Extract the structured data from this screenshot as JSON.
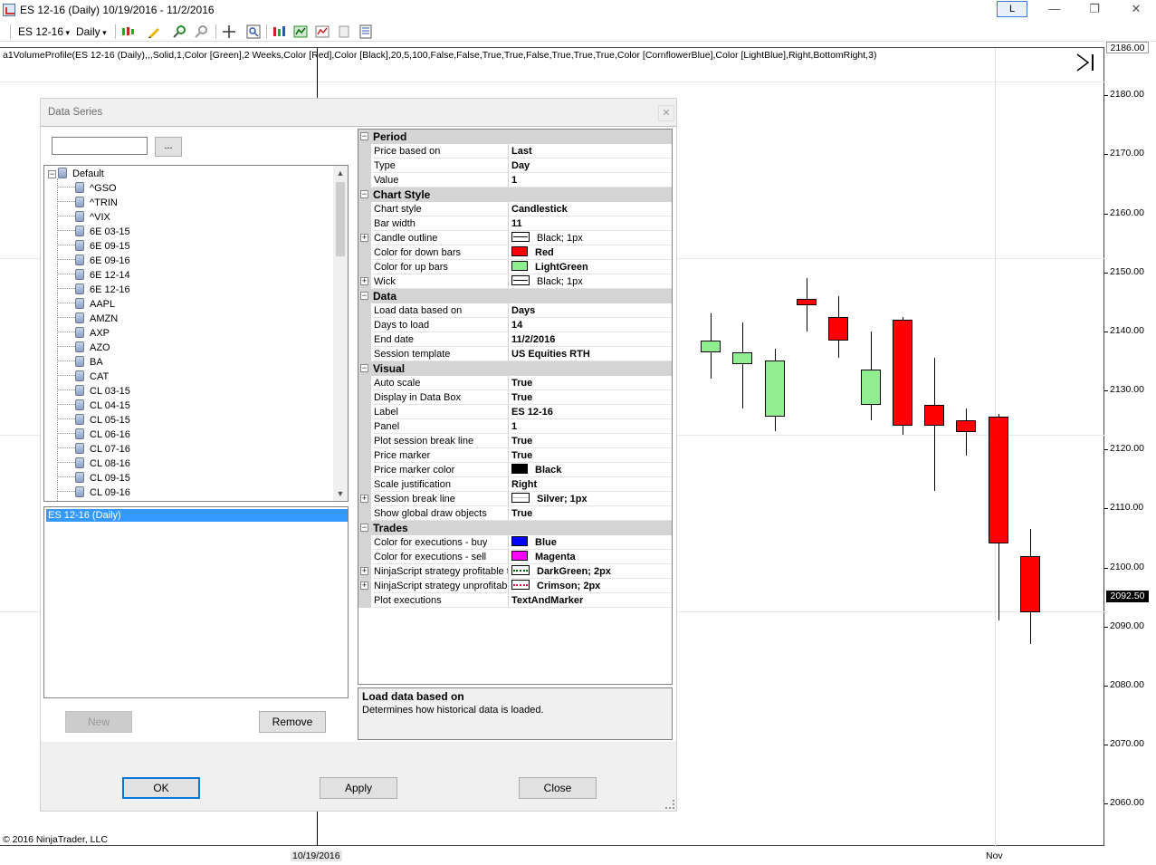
{
  "window": {
    "title": "ES 12-16 (Daily)  10/19/2016 - 11/2/2016",
    "layout_button": "L",
    "minimize": "—",
    "restore": "❐",
    "close": "✕"
  },
  "toolbar": {
    "instrument": "ES 12-16",
    "interval": "Daily"
  },
  "chart": {
    "indicator_label": "a1VolumeProfile(ES 12-16 (Daily),,,Solid,1,Color [Green],2 Weeks,Color [Red],Color [Black],20,5,100,False,False,True,True,False,True,True,True,Color [CornflowerBlue],Color [LightBlue],Right,BottomRight,3)",
    "copyright": "© 2016 NinjaTrader, LLC",
    "y_ticks": [
      "2180.00",
      "2170.00",
      "2160.00",
      "2150.00",
      "2140.00",
      "2130.00",
      "2120.00",
      "2110.00",
      "2100.00",
      "2090.00",
      "2080.00",
      "2070.00",
      "2060.00"
    ],
    "top_price_tag": "2186.00",
    "last_price_tag": "2092.50",
    "x_labels": [
      "10/19/2016",
      "Nov"
    ],
    "colors": {
      "up": "#90ee90",
      "down": "#ff0000",
      "tag_bg": "#000000"
    }
  },
  "chart_data": {
    "type": "candlestick",
    "ylim": [
      2053,
      2188
    ],
    "candles": [
      {
        "o": 2136.5,
        "h": 2143.0,
        "l": 2132.0,
        "c": 2138.5,
        "dir": "up"
      },
      {
        "o": 2134.5,
        "h": 2141.5,
        "l": 2127.0,
        "c": 2136.5,
        "dir": "up"
      },
      {
        "o": 2125.5,
        "h": 2137.0,
        "l": 2123.0,
        "c": 2135.0,
        "dir": "up"
      },
      {
        "o": 2145.5,
        "h": 2149.0,
        "l": 2140.0,
        "c": 2144.5,
        "dir": "down"
      },
      {
        "o": 2142.5,
        "h": 2146.0,
        "l": 2135.5,
        "c": 2138.5,
        "dir": "down"
      },
      {
        "o": 2127.5,
        "h": 2140.0,
        "l": 2125.0,
        "c": 2133.5,
        "dir": "up"
      },
      {
        "o": 2142.0,
        "h": 2142.5,
        "l": 2122.5,
        "c": 2124.0,
        "dir": "down"
      },
      {
        "o": 2127.5,
        "h": 2135.5,
        "l": 2113.0,
        "c": 2124.0,
        "dir": "down"
      },
      {
        "o": 2125.0,
        "h": 2127.0,
        "l": 2119.0,
        "c": 2123.0,
        "dir": "down"
      },
      {
        "o": 2125.5,
        "h": 2126.0,
        "l": 2091.0,
        "c": 2104.0,
        "dir": "down"
      },
      {
        "o": 2102.0,
        "h": 2106.5,
        "l": 2087.0,
        "c": 2092.5,
        "dir": "down"
      }
    ]
  },
  "dialog": {
    "title": "Data Series",
    "close_label": "✕",
    "search_value": "",
    "browse_label": "...",
    "tree_root": "Default",
    "instruments": [
      "^GSO",
      "^TRIN",
      "^VIX",
      "6E 03-15",
      "6E 09-15",
      "6E 09-16",
      "6E 12-14",
      "6E 12-16",
      "AAPL",
      "AMZN",
      "AXP",
      "AZO",
      "BA",
      "CAT",
      "CL 03-15",
      "CL 04-15",
      "CL 05-15",
      "CL 06-16",
      "CL 07-16",
      "CL 08-16",
      "CL 09-15",
      "CL 09-16"
    ],
    "selected_series": "ES 12-16 (Daily)",
    "new_label": "New",
    "remove_label": "Remove",
    "ok_label": "OK",
    "apply_label": "Apply",
    "close_button_label": "Close",
    "help_title": "Load data based on",
    "help_desc": "Determines how historical data is loaded.",
    "properties": [
      {
        "kind": "cat",
        "name": "Period"
      },
      {
        "kind": "prop",
        "name": "Price based on",
        "value": "Last"
      },
      {
        "kind": "prop",
        "name": "Type",
        "value": "Day"
      },
      {
        "kind": "prop",
        "name": "Value",
        "value": "1"
      },
      {
        "kind": "cat",
        "name": "Chart Style"
      },
      {
        "kind": "prop",
        "name": "Chart style",
        "value": "Candlestick"
      },
      {
        "kind": "prop",
        "name": "Bar width",
        "value": "11"
      },
      {
        "kind": "prop",
        "name": "Candle outline",
        "value": "Black; 1px",
        "swatch": "line",
        "exp": true
      },
      {
        "kind": "prop",
        "name": "Color for down bars",
        "value": "Red",
        "swatch": "#ff0000"
      },
      {
        "kind": "prop",
        "name": "Color for up bars",
        "value": "LightGreen",
        "swatch": "#90ee90"
      },
      {
        "kind": "prop",
        "name": "Wick",
        "value": "Black; 1px",
        "swatch": "line",
        "exp": true
      },
      {
        "kind": "cat",
        "name": "Data"
      },
      {
        "kind": "prop",
        "name": "Load data based on",
        "value": "Days"
      },
      {
        "kind": "prop",
        "name": "Days to load",
        "value": "14"
      },
      {
        "kind": "prop",
        "name": "End date",
        "value": "11/2/2016"
      },
      {
        "kind": "prop",
        "name": "Session template",
        "value": "US Equities RTH"
      },
      {
        "kind": "cat",
        "name": "Visual"
      },
      {
        "kind": "prop",
        "name": "Auto scale",
        "value": "True"
      },
      {
        "kind": "prop",
        "name": "Display in Data Box",
        "value": "True"
      },
      {
        "kind": "prop",
        "name": "Label",
        "value": "ES 12-16"
      },
      {
        "kind": "prop",
        "name": "Panel",
        "value": "1"
      },
      {
        "kind": "prop",
        "name": "Plot session break line",
        "value": "True"
      },
      {
        "kind": "prop",
        "name": "Price marker",
        "value": "True"
      },
      {
        "kind": "prop",
        "name": "Price marker color",
        "value": "Black",
        "swatch": "#000000"
      },
      {
        "kind": "prop",
        "name": "Scale justification",
        "value": "Right"
      },
      {
        "kind": "prop",
        "name": "Session break line",
        "value": "Silver; 1px",
        "swatch": "silver",
        "exp": true
      },
      {
        "kind": "prop",
        "name": "Show global draw objects",
        "value": "True"
      },
      {
        "kind": "cat",
        "name": "Trades"
      },
      {
        "kind": "prop",
        "name": "Color for executions - buy",
        "value": "Blue",
        "swatch": "#0000ff"
      },
      {
        "kind": "prop",
        "name": "Color for executions - sell",
        "value": "Magenta",
        "swatch": "#ff00ff"
      },
      {
        "kind": "prop",
        "name": "NinjaScript strategy profitable t",
        "value": "DarkGreen; 2px",
        "swatch": "dg",
        "exp": true
      },
      {
        "kind": "prop",
        "name": "NinjaScript strategy unprofitable",
        "value": "Crimson; 2px",
        "swatch": "cr",
        "exp": true
      },
      {
        "kind": "prop",
        "name": "Plot executions",
        "value": "TextAndMarker"
      }
    ]
  }
}
